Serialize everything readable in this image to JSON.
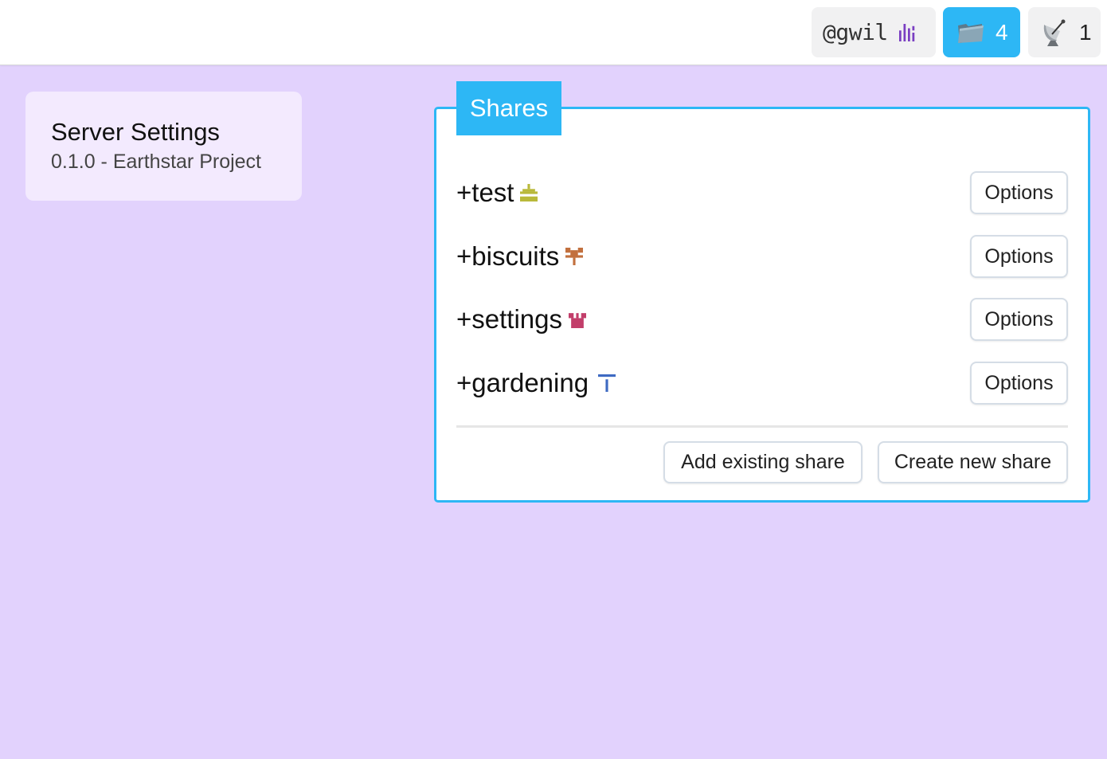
{
  "topbar": {
    "identity": {
      "handle": "@gwil",
      "glyph_color": "#7a3fc2"
    },
    "shares_button": {
      "icon": "folder-icon",
      "count": "4",
      "color": "#2db7f5"
    },
    "servers_button": {
      "icon": "satellite-dish-icon",
      "count": "1"
    }
  },
  "server_card": {
    "title": "Server Settings",
    "subtitle": "0.1.0 - Earthstar Project"
  },
  "shares_panel": {
    "tab_label": "Shares",
    "accent": "#2db7f5",
    "shares": [
      {
        "name": "+test",
        "glyph_color": "#b9b93a",
        "options_label": "Options"
      },
      {
        "name": "+biscuits",
        "glyph_color": "#c2703e",
        "options_label": "Options"
      },
      {
        "name": "+settings",
        "glyph_color": "#c23e6a",
        "options_label": "Options"
      },
      {
        "name": "+gardening",
        "glyph_color": "#3e6ac2",
        "options_label": "Options"
      }
    ],
    "add_existing_label": "Add existing share",
    "create_new_label": "Create new share"
  }
}
